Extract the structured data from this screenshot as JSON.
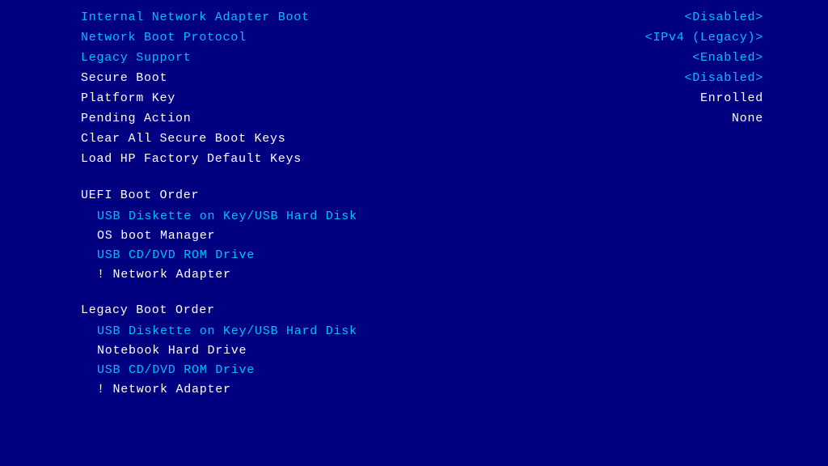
{
  "bios": {
    "rows": [
      {
        "label": "Internal Network Adapter Boot",
        "value": "<Disabled>",
        "labelColor": "blue",
        "valueColor": "blue"
      },
      {
        "label": "Network Boot Protocol",
        "value": "<IPv4 (Legacy)>",
        "labelColor": "blue",
        "valueColor": "blue"
      },
      {
        "label": "Legacy Support",
        "value": "<Enabled>",
        "labelColor": "blue",
        "valueColor": "blue"
      },
      {
        "label": "Secure Boot",
        "value": "<Disabled>",
        "labelColor": "white",
        "valueColor": "blue"
      },
      {
        "label": "Platform Key",
        "value": "Enrolled",
        "labelColor": "white",
        "valueColor": "white"
      },
      {
        "label": "Pending Action",
        "value": "None",
        "labelColor": "white",
        "valueColor": "white"
      },
      {
        "label": "Clear All Secure Boot Keys",
        "value": "",
        "labelColor": "white",
        "valueColor": "white"
      },
      {
        "label": "Load HP Factory Default Keys",
        "value": "",
        "labelColor": "white",
        "valueColor": "white"
      }
    ],
    "uefi_section": "UEFI Boot Order",
    "uefi_items": [
      "USB Diskette on Key/USB Hard Disk",
      "OS boot Manager",
      "USB CD/DVD ROM Drive",
      "! Network Adapter"
    ],
    "legacy_section": "Legacy Boot Order",
    "legacy_items": [
      "USB Diskette on Key/USB Hard Disk",
      "Notebook Hard Drive",
      "USB CD/DVD ROM Drive",
      "! Network Adapter"
    ]
  }
}
